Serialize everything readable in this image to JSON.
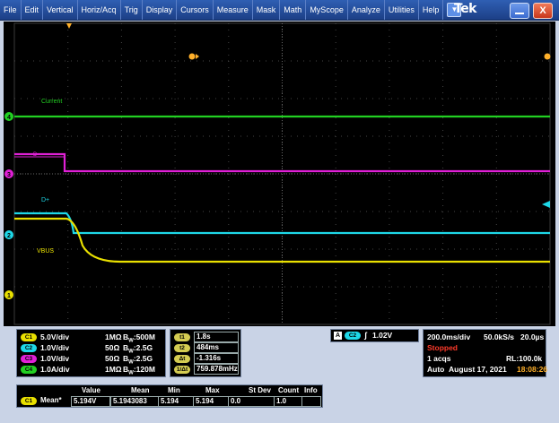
{
  "menu": {
    "items": [
      "File",
      "Edit",
      "Vertical",
      "Horiz/Acq",
      "Trig",
      "Display",
      "Cursors",
      "Measure",
      "Mask",
      "Math",
      "MyScope",
      "Analyze",
      "Utilities",
      "Help"
    ],
    "dropdown_icon": "chevron-down-icon",
    "brand": "Tek"
  },
  "waveforms": {
    "current_label": "Current",
    "dplus_label": "D+",
    "dminus_label": "D-",
    "vbus_label": "VBUS",
    "colors": {
      "ch1": "#e9e000",
      "ch2": "#1ed8e8",
      "ch3": "#e020d6",
      "ch4": "#22d022"
    },
    "ch_markers": [
      "4",
      "3",
      "2",
      "1"
    ]
  },
  "channels": [
    {
      "badge": "C1",
      "scale": "5.0V/div",
      "impedance": "1MΩ",
      "bw": "500M"
    },
    {
      "badge": "C2",
      "scale": "1.0V/div",
      "impedance": "50Ω",
      "bw": "2.5G"
    },
    {
      "badge": "C3",
      "scale": "1.0V/div",
      "impedance": "50Ω",
      "bw": "2.5G"
    },
    {
      "badge": "C4",
      "scale": "1.0A/div",
      "impedance": "1MΩ",
      "bw": "120M"
    }
  ],
  "bw_prefix": "B",
  "bw_sub": "W",
  "cursors": [
    {
      "badge": "t1",
      "value": "1.8s"
    },
    {
      "badge": "t2",
      "value": "484ms"
    },
    {
      "badge": "Δt",
      "value": "-1.316s"
    },
    {
      "badge": "1/Δt",
      "value": "759.878mHz"
    }
  ],
  "trigger": {
    "mode_badge": "A",
    "channel_badge": "C2",
    "slope_icon": "rising-edge-icon",
    "level": "1.02V"
  },
  "horizontal": {
    "scale": "200.0ms/div",
    "rate": "50.0kS/s",
    "resolution": "20.0µs",
    "status": "Stopped",
    "acqs": "1 acqs",
    "record_length": "RL:100.0k",
    "mode": "Auto",
    "date": "August 17, 2021",
    "time": "18:08:26"
  },
  "measurements": {
    "headers": [
      "Value",
      "Mean",
      "Min",
      "Max",
      "St Dev",
      "Count",
      "Info"
    ],
    "rows": [
      {
        "badge": "C1",
        "name": "Mean*",
        "value": "5.194V",
        "mean": "5.1943083",
        "min": "5.194",
        "max": "5.194",
        "stdev": "0.0",
        "count": "1.0",
        "info": ""
      }
    ]
  }
}
